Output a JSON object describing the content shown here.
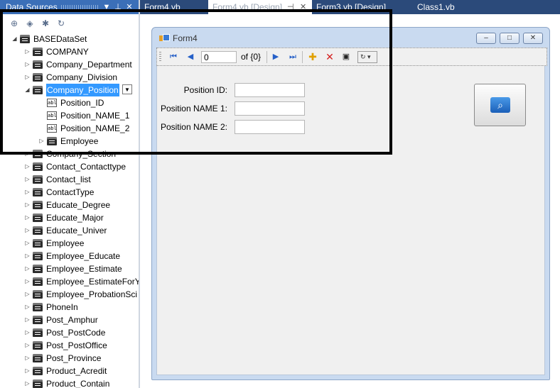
{
  "data_sources_panel": {
    "title": "Data Sources",
    "title_icons": [
      "dropdown-icon",
      "pin-icon",
      "close-icon"
    ],
    "toolbar_icons": [
      "add-data-source-icon",
      "edit-dataset-icon",
      "configure-dataset-icon",
      "refresh-icon"
    ],
    "tree": [
      {
        "label": "BASEDataSet",
        "icon": "dataset-icon",
        "level": 0,
        "expander": "expanded"
      },
      {
        "label": "COMPANY",
        "icon": "table-icon",
        "level": 1,
        "expander": "collapsed"
      },
      {
        "label": "Company_Department",
        "icon": "table-icon",
        "level": 1,
        "expander": "collapsed"
      },
      {
        "label": "Company_Division",
        "icon": "table-icon",
        "level": 1,
        "expander": "collapsed"
      },
      {
        "label": "Company_Position",
        "icon": "table-icon",
        "level": 1,
        "expander": "expanded",
        "selected": true
      },
      {
        "label": "Position_ID",
        "icon": "textbox-field-icon",
        "level": 2,
        "expander": "none"
      },
      {
        "label": "Position_NAME_1",
        "icon": "textbox-field-icon",
        "level": 2,
        "expander": "none"
      },
      {
        "label": "Position_NAME_2",
        "icon": "textbox-field-icon",
        "level": 2,
        "expander": "none"
      },
      {
        "label": "Employee",
        "icon": "table-icon",
        "level": 2,
        "expander": "collapsed"
      },
      {
        "label": "Company_Section",
        "icon": "table-icon",
        "level": 1,
        "expander": "collapsed"
      },
      {
        "label": "Contact_Contacttype",
        "icon": "table-icon",
        "level": 1,
        "expander": "collapsed"
      },
      {
        "label": "Contact_list",
        "icon": "table-icon",
        "level": 1,
        "expander": "collapsed"
      },
      {
        "label": "ContactType",
        "icon": "table-icon",
        "level": 1,
        "expander": "collapsed"
      },
      {
        "label": "Educate_Degree",
        "icon": "table-icon",
        "level": 1,
        "expander": "collapsed"
      },
      {
        "label": "Educate_Major",
        "icon": "table-icon",
        "level": 1,
        "expander": "collapsed"
      },
      {
        "label": "Educate_Univer",
        "icon": "table-icon",
        "level": 1,
        "expander": "collapsed"
      },
      {
        "label": "Employee",
        "icon": "table-icon",
        "level": 1,
        "expander": "collapsed"
      },
      {
        "label": "Employee_Educate",
        "icon": "table-icon",
        "level": 1,
        "expander": "collapsed"
      },
      {
        "label": "Employee_Estimate",
        "icon": "table-icon",
        "level": 1,
        "expander": "collapsed"
      },
      {
        "label": "Employee_EstimateForY",
        "icon": "table-icon",
        "level": 1,
        "expander": "collapsed"
      },
      {
        "label": "Employee_ProbationSci",
        "icon": "table-icon",
        "level": 1,
        "expander": "collapsed"
      },
      {
        "label": "PhoneIn",
        "icon": "table-icon",
        "level": 1,
        "expander": "collapsed"
      },
      {
        "label": "Post_Amphur",
        "icon": "table-icon",
        "level": 1,
        "expander": "collapsed"
      },
      {
        "label": "Post_PostCode",
        "icon": "table-icon",
        "level": 1,
        "expander": "collapsed"
      },
      {
        "label": "Post_PostOffice",
        "icon": "table-icon",
        "level": 1,
        "expander": "collapsed"
      },
      {
        "label": "Post_Province",
        "icon": "table-icon",
        "level": 1,
        "expander": "collapsed"
      },
      {
        "label": "Product_Acredit",
        "icon": "table-icon",
        "level": 1,
        "expander": "collapsed"
      },
      {
        "label": "Product_Contain",
        "icon": "table-icon",
        "level": 1,
        "expander": "collapsed"
      }
    ]
  },
  "document_tabs": [
    {
      "label": "Form4.vb",
      "active": false
    },
    {
      "label": "Form4.vb [Design]",
      "active": true
    },
    {
      "label": "Form3.vb [Design]",
      "active": false
    },
    {
      "label": "Class1.vb",
      "active": false
    }
  ],
  "form": {
    "title": "Form4",
    "window_buttons": [
      "minimize-icon",
      "maximize-icon",
      "close-icon"
    ],
    "navigator": {
      "position_value": "0",
      "count_text": "of {0}",
      "buttons": [
        "move-first-icon",
        "move-previous-icon",
        "move-next-icon",
        "move-last-icon",
        "add-new-icon",
        "delete-icon",
        "save-icon"
      ]
    },
    "fields": [
      {
        "label": "Position ID:",
        "value": ""
      },
      {
        "label": "Position NAME 1:",
        "value": ""
      },
      {
        "label": "Position NAME 2:",
        "value": ""
      }
    ],
    "search_button_icon": "search-icon"
  },
  "colors": {
    "panel_title_bg": "#3b6fb8",
    "tab_strip_bg": "#2b4a7a",
    "selection": "#3399ff",
    "form_frame": "#c9daf0",
    "highlight_border": "#000000"
  }
}
